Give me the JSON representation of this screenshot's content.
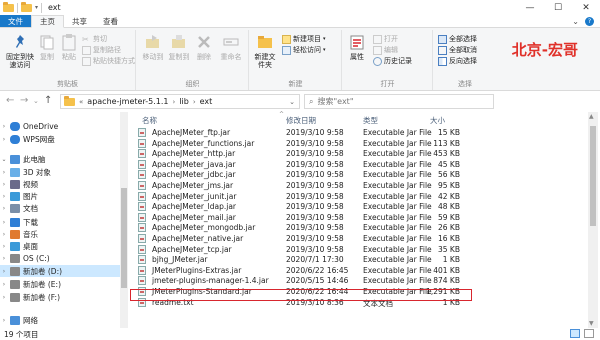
{
  "window": {
    "title": "ext"
  },
  "tabs": [
    "文件",
    "主页",
    "共享",
    "查看"
  ],
  "ribbon": {
    "clipboard": {
      "pin": "固定到快速访问",
      "copy": "复制",
      "paste": "粘贴",
      "cut": "剪切",
      "copy_path": "复制路径",
      "paste_shortcut": "粘贴快捷方式",
      "label": "剪贴板"
    },
    "organize": {
      "move_to": "移动到",
      "copy_to": "复制到",
      "delete": "删除",
      "rename": "重命名",
      "label": "组织"
    },
    "new": {
      "new_folder": "新建文件夹",
      "new_item": "新建项目",
      "easy_access": "轻松访问",
      "label": "新建"
    },
    "open": {
      "properties": "属性",
      "open": "打开",
      "edit": "编辑",
      "history": "历史记录",
      "label": "打开"
    },
    "select": {
      "select_all": "全部选择",
      "select_none": "全部取消",
      "invert": "反向选择",
      "label": "选择"
    },
    "brand": "北京-宏哥"
  },
  "address": {
    "prefix": "«",
    "crumbs": [
      "apache-jmeter-5.1.1",
      "lib",
      "ext"
    ],
    "search_placeholder": "搜索\"ext\""
  },
  "nav": [
    {
      "label": "OneDrive",
      "chev": "›",
      "icon": "cloud"
    },
    {
      "label": "WPS网盘",
      "chev": "›",
      "icon": "cloud"
    },
    {
      "label": "此电脑",
      "chev": "⌄",
      "icon": "pc"
    },
    {
      "label": "3D 对象",
      "chev": "›",
      "icon": "cube"
    },
    {
      "label": "视频",
      "chev": "›",
      "icon": "video"
    },
    {
      "label": "图片",
      "chev": "›",
      "icon": "picture"
    },
    {
      "label": "文档",
      "chev": "›",
      "icon": "doc"
    },
    {
      "label": "下载",
      "chev": "›",
      "icon": "download"
    },
    {
      "label": "音乐",
      "chev": "›",
      "icon": "music"
    },
    {
      "label": "桌面",
      "chev": "›",
      "icon": "desktop"
    },
    {
      "label": "OS (C:)",
      "chev": "›",
      "icon": "drive"
    },
    {
      "label": "新加卷 (D:)",
      "chev": "›",
      "icon": "drive",
      "selected": true
    },
    {
      "label": "新加卷 (E:)",
      "chev": "›",
      "icon": "drive"
    },
    {
      "label": "新加卷 (F:)",
      "chev": "›",
      "icon": "drive"
    },
    {
      "label": "网络",
      "chev": "›",
      "icon": "network"
    }
  ],
  "columns": {
    "name": "名称",
    "date": "修改日期",
    "type": "类型",
    "size": "大小"
  },
  "files": [
    {
      "name": "ApacheJMeter_ftp.jar",
      "date": "2019/3/10 9:58",
      "type": "Executable Jar File",
      "size": "15 KB"
    },
    {
      "name": "ApacheJMeter_functions.jar",
      "date": "2019/3/10 9:58",
      "type": "Executable Jar File",
      "size": "113 KB"
    },
    {
      "name": "ApacheJMeter_http.jar",
      "date": "2019/3/10 9:58",
      "type": "Executable Jar File",
      "size": "453 KB"
    },
    {
      "name": "ApacheJMeter_java.jar",
      "date": "2019/3/10 9:58",
      "type": "Executable Jar File",
      "size": "45 KB"
    },
    {
      "name": "ApacheJMeter_jdbc.jar",
      "date": "2019/3/10 9:58",
      "type": "Executable Jar File",
      "size": "56 KB"
    },
    {
      "name": "ApacheJMeter_jms.jar",
      "date": "2019/3/10 9:58",
      "type": "Executable Jar File",
      "size": "95 KB"
    },
    {
      "name": "ApacheJMeter_junit.jar",
      "date": "2019/3/10 9:58",
      "type": "Executable Jar File",
      "size": "42 KB"
    },
    {
      "name": "ApacheJMeter_ldap.jar",
      "date": "2019/3/10 9:58",
      "type": "Executable Jar File",
      "size": "48 KB"
    },
    {
      "name": "ApacheJMeter_mail.jar",
      "date": "2019/3/10 9:58",
      "type": "Executable Jar File",
      "size": "59 KB"
    },
    {
      "name": "ApacheJMeter_mongodb.jar",
      "date": "2019/3/10 9:58",
      "type": "Executable Jar File",
      "size": "26 KB"
    },
    {
      "name": "ApacheJMeter_native.jar",
      "date": "2019/3/10 9:58",
      "type": "Executable Jar File",
      "size": "16 KB"
    },
    {
      "name": "ApacheJMeter_tcp.jar",
      "date": "2019/3/10 9:58",
      "type": "Executable Jar File",
      "size": "35 KB"
    },
    {
      "name": "bjhg_JMeter.jar",
      "date": "2020/7/1 17:30",
      "type": "Executable Jar File",
      "size": "1 KB"
    },
    {
      "name": "JMeterPlugins-Extras.jar",
      "date": "2020/6/22 16:45",
      "type": "Executable Jar File",
      "size": "401 KB"
    },
    {
      "name": "jmeter-plugins-manager-1.4.jar",
      "date": "2020/5/15 14:46",
      "type": "Executable Jar File",
      "size": "874 KB",
      "highlighted": true
    },
    {
      "name": "JMeterPlugins-Standard.jar",
      "date": "2020/6/22 16:44",
      "type": "Executable Jar File",
      "size": "1,291 KB"
    },
    {
      "name": "readme.txt",
      "date": "2019/3/10 8:36",
      "type": "文本文档",
      "size": "1 KB",
      "txt": true
    }
  ],
  "status": {
    "count": "19 个项目"
  },
  "colors": {
    "accent": "#1979ca",
    "highlight": "#d8262e",
    "brand": "#e0312a",
    "selected": "#cce8ff"
  }
}
